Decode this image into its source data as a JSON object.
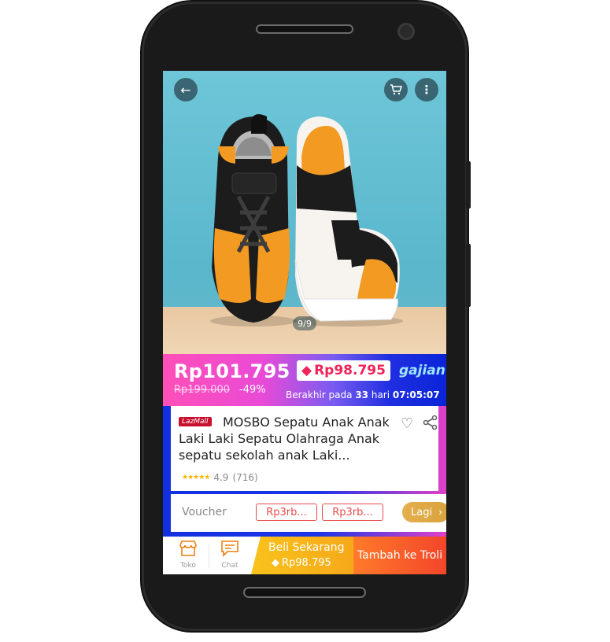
{
  "header": {
    "back_icon": "arrow-left-icon",
    "cart_icon": "cart-icon",
    "more_icon": "more-vertical-icon"
  },
  "gallery": {
    "counter": "9/9"
  },
  "price": {
    "current": "Rp101.795",
    "original": "Rp199.000",
    "discount": "-49%",
    "voucher_price": "Rp98.795",
    "banner_brand": "gajian",
    "ends_prefix": "Berakhir pada",
    "ends_days": "33",
    "ends_days_unit": "hari",
    "ends_time": "07:05:07"
  },
  "product": {
    "badge": "LazMall",
    "title": "MOSBO Sepatu Anak Anak Laki Laki Sepatu Olahraga Anak sepatu sekolah anak Laki...",
    "rating": "4.9",
    "reviews": "(716)"
  },
  "vouchers": {
    "label": "Voucher",
    "chips": [
      "Rp3rb...",
      "Rp3rb..."
    ],
    "more": "Lagi"
  },
  "bottom": {
    "store_label": "Toko",
    "chat_label": "Chat",
    "buy_now": "Beli Sekarang",
    "buy_price": "Rp98.795",
    "add_cart": "Tambah ke Troli"
  },
  "colors": {
    "accent_red": "#f0245a",
    "buy_yellow": "#f9c21b",
    "cart_orange": "#f2462a",
    "store_orange": "#f07e10"
  }
}
